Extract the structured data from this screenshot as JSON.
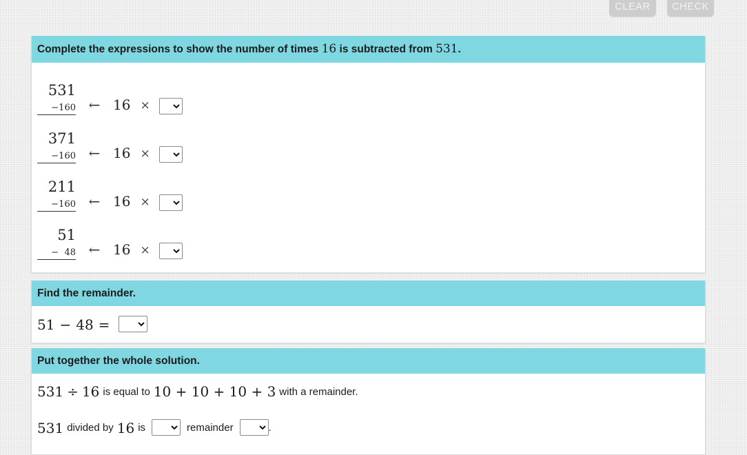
{
  "toolbar": {
    "clear_label": "CLEAR",
    "check_label": "CHECK"
  },
  "colors": {
    "header_teal": "#7fd7e1",
    "page_background": "#f3f3f3",
    "card_background": "#ffffff",
    "button_disabled": "#cdcdcd",
    "text": "#1b1b1b"
  },
  "sections": {
    "expressions": {
      "heading_part1": "Complete the expressions to show the number of times",
      "heading_number1": "16",
      "heading_part2": "is subtracted from",
      "heading_number2": "531",
      "heading_end": ".",
      "rows": [
        {
          "minuend": "531",
          "subtrahend": "−160",
          "arrow": "←",
          "factor": "16",
          "times": "×",
          "answer": ""
        },
        {
          "minuend": "371",
          "subtrahend": "−160",
          "arrow": "←",
          "factor": "16",
          "times": "×",
          "answer": ""
        },
        {
          "minuend": "211",
          "subtrahend": "−160",
          "arrow": "←",
          "factor": "16",
          "times": "×",
          "answer": ""
        },
        {
          "minuend": "51",
          "subtrahend": "−  48",
          "arrow": "←",
          "factor": "16",
          "times": "×",
          "answer": ""
        }
      ]
    },
    "remainder": {
      "heading": "Find the remainder.",
      "left": "51",
      "minus": "−",
      "right": "48",
      "equals": "=",
      "answer": ""
    },
    "solution": {
      "heading": "Put together the whole solution.",
      "line1": {
        "dividend": "531",
        "divide_sign": "÷",
        "divisor": "16",
        "mid_text": "is equal to",
        "sum": "10 + 10 + 10 + 3",
        "end_text": "with a remainder."
      },
      "line2": {
        "dividend": "531",
        "text_divided_by": "divided by",
        "divisor": "16",
        "text_is": "is",
        "quotient_answer": "",
        "text_remainder": "remainder",
        "remainder_answer": "",
        "period": "."
      }
    }
  }
}
